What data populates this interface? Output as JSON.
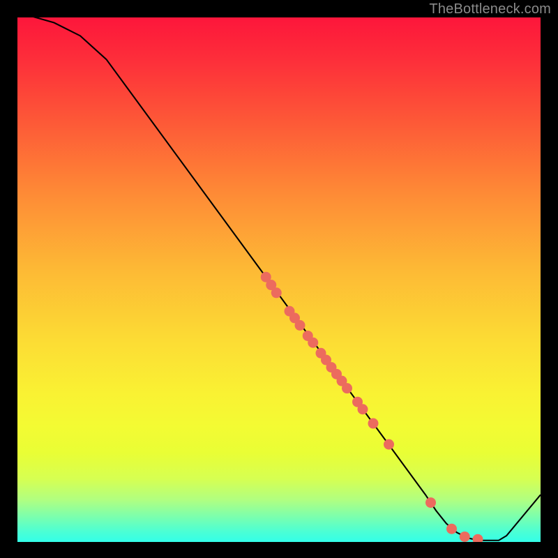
{
  "watermark": "TheBottleneck.com",
  "chart_data": {
    "type": "line",
    "title": "",
    "xlabel": "",
    "ylabel": "",
    "xlim": [
      0,
      100
    ],
    "ylim": [
      0,
      100
    ],
    "curve": [
      {
        "x": 0,
        "y": 101
      },
      {
        "x": 7,
        "y": 99
      },
      {
        "x": 12,
        "y": 96.5
      },
      {
        "x": 17,
        "y": 92
      },
      {
        "x": 78,
        "y": 9
      },
      {
        "x": 80,
        "y": 6
      },
      {
        "x": 82,
        "y": 3.5
      },
      {
        "x": 84,
        "y": 1.8
      },
      {
        "x": 86,
        "y": 0.8
      },
      {
        "x": 88,
        "y": 0.3
      },
      {
        "x": 92,
        "y": 0.3
      },
      {
        "x": 93.5,
        "y": 1.2
      },
      {
        "x": 100,
        "y": 9
      }
    ],
    "scatter": [
      {
        "x": 47.5,
        "y": 50.5
      },
      {
        "x": 48.5,
        "y": 49.0
      },
      {
        "x": 49.5,
        "y": 47.5
      },
      {
        "x": 52.0,
        "y": 44.0
      },
      {
        "x": 53.0,
        "y": 42.7
      },
      {
        "x": 54.0,
        "y": 41.3
      },
      {
        "x": 55.5,
        "y": 39.3
      },
      {
        "x": 56.5,
        "y": 38.0
      },
      {
        "x": 58.0,
        "y": 36.0
      },
      {
        "x": 59.0,
        "y": 34.7
      },
      {
        "x": 60.0,
        "y": 33.3
      },
      {
        "x": 61.0,
        "y": 32.0
      },
      {
        "x": 62.0,
        "y": 30.7
      },
      {
        "x": 63.0,
        "y": 29.3
      },
      {
        "x": 65.0,
        "y": 26.7
      },
      {
        "x": 66.0,
        "y": 25.3
      },
      {
        "x": 68.0,
        "y": 22.6
      },
      {
        "x": 71.0,
        "y": 18.6
      },
      {
        "x": 79.0,
        "y": 7.5
      },
      {
        "x": 83.0,
        "y": 2.5
      },
      {
        "x": 85.5,
        "y": 1.0
      },
      {
        "x": 88.0,
        "y": 0.5
      }
    ],
    "dot_radius_pct": 1.0
  }
}
